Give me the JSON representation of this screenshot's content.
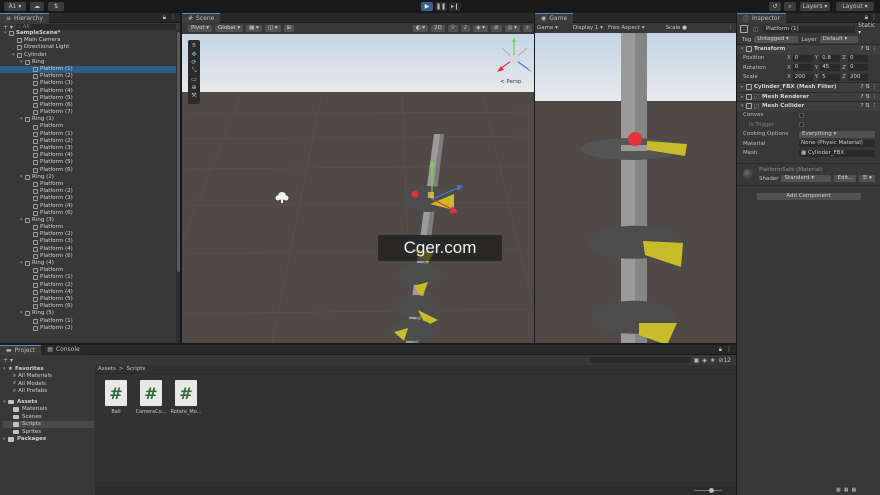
{
  "toolbar": {
    "account": "A1 ▾",
    "layers": "Layers",
    "layout": "Layout"
  },
  "hierarchy": {
    "tab": "Hierarchy",
    "search_placeholder": "All",
    "rows": [
      {
        "label": "SampleScene*",
        "depth": 0,
        "arrow": "▾",
        "bold": true
      },
      {
        "label": "Main Camera",
        "depth": 1,
        "arrow": ""
      },
      {
        "label": "Directional Light",
        "depth": 1,
        "arrow": ""
      },
      {
        "label": "Cylinder",
        "depth": 1,
        "arrow": "▾"
      },
      {
        "label": "Ring",
        "depth": 2,
        "arrow": "▾"
      },
      {
        "label": "Platform (1)",
        "depth": 3,
        "arrow": "",
        "selected": true
      },
      {
        "label": "Platform (2)",
        "depth": 3,
        "arrow": ""
      },
      {
        "label": "Platform (3)",
        "depth": 3,
        "arrow": ""
      },
      {
        "label": "Platform (4)",
        "depth": 3,
        "arrow": ""
      },
      {
        "label": "Platform (5)",
        "depth": 3,
        "arrow": ""
      },
      {
        "label": "Platform (6)",
        "depth": 3,
        "arrow": ""
      },
      {
        "label": "Platform (7)",
        "depth": 3,
        "arrow": ""
      },
      {
        "label": "Ring (1)",
        "depth": 2,
        "arrow": "▾"
      },
      {
        "label": "Platform",
        "depth": 3,
        "arrow": ""
      },
      {
        "label": "Platform (1)",
        "depth": 3,
        "arrow": ""
      },
      {
        "label": "Platform (2)",
        "depth": 3,
        "arrow": ""
      },
      {
        "label": "Platform (3)",
        "depth": 3,
        "arrow": ""
      },
      {
        "label": "Platform (4)",
        "depth": 3,
        "arrow": ""
      },
      {
        "label": "Platform (5)",
        "depth": 3,
        "arrow": ""
      },
      {
        "label": "Platform (6)",
        "depth": 3,
        "arrow": ""
      },
      {
        "label": "Ring (2)",
        "depth": 2,
        "arrow": "▾"
      },
      {
        "label": "Platform",
        "depth": 3,
        "arrow": ""
      },
      {
        "label": "Platform (2)",
        "depth": 3,
        "arrow": ""
      },
      {
        "label": "Platform (3)",
        "depth": 3,
        "arrow": ""
      },
      {
        "label": "Platform (4)",
        "depth": 3,
        "arrow": ""
      },
      {
        "label": "Platform (6)",
        "depth": 3,
        "arrow": ""
      },
      {
        "label": "Ring (3)",
        "depth": 2,
        "arrow": "▾"
      },
      {
        "label": "Platform",
        "depth": 3,
        "arrow": ""
      },
      {
        "label": "Platform (2)",
        "depth": 3,
        "arrow": ""
      },
      {
        "label": "Platform (3)",
        "depth": 3,
        "arrow": ""
      },
      {
        "label": "Platform (4)",
        "depth": 3,
        "arrow": ""
      },
      {
        "label": "Platform (6)",
        "depth": 3,
        "arrow": ""
      },
      {
        "label": "Ring (4)",
        "depth": 2,
        "arrow": "▾"
      },
      {
        "label": "Platform",
        "depth": 3,
        "arrow": ""
      },
      {
        "label": "Platform (1)",
        "depth": 3,
        "arrow": ""
      },
      {
        "label": "Platform (2)",
        "depth": 3,
        "arrow": ""
      },
      {
        "label": "Platform (4)",
        "depth": 3,
        "arrow": ""
      },
      {
        "label": "Platform (5)",
        "depth": 3,
        "arrow": ""
      },
      {
        "label": "Platform (6)",
        "depth": 3,
        "arrow": ""
      },
      {
        "label": "Ring (5)",
        "depth": 2,
        "arrow": "▾"
      },
      {
        "label": "Platform (1)",
        "depth": 3,
        "arrow": ""
      },
      {
        "label": "Platform (2)",
        "depth": 3,
        "arrow": ""
      }
    ]
  },
  "scene": {
    "tab": "Scene",
    "pivot": "Pivot",
    "global": "Global",
    "mode_2d": "2D",
    "persp": "< Persp"
  },
  "game": {
    "tab": "Game",
    "mode": "Game",
    "display": "Display 1",
    "aspect": "Free Aspect",
    "scale": "Scale"
  },
  "inspector": {
    "tab": "Inspector",
    "object_name": "Platform (1)",
    "static_label": "Static",
    "tag_label": "Tag",
    "tag_value": "Untagged",
    "layer_label": "Layer",
    "layer_value": "Default",
    "transform": {
      "title": "Transform",
      "rows": [
        {
          "label": "Position",
          "x": "0",
          "y": "0.8",
          "z": "0"
        },
        {
          "label": "Rotation",
          "x": "0",
          "y": "45",
          "z": "0"
        },
        {
          "label": "Scale",
          "x": "200",
          "y": "5",
          "z": "200"
        }
      ]
    },
    "components": [
      {
        "title": "Cylinder_FBX (Mesh Filter)",
        "checkbox": false
      },
      {
        "title": "Mesh Renderer",
        "checkbox": true
      },
      {
        "title": "Mesh Collider",
        "checkbox": true
      }
    ],
    "collider": {
      "convex": "Convex",
      "is_trigger": "Is Trigger",
      "cooking_label": "Cooking Options",
      "cooking_value": "Everything",
      "material_label": "Material",
      "material_value": "None (Physic Material)",
      "mesh_label": "Mesh",
      "mesh_value": "Cylinder_FBX"
    },
    "material": {
      "title": "PlatformSafe (Material)",
      "shader_label": "Shader",
      "shader_value": "Standard",
      "edit": "Edit..."
    },
    "add_component": "Add Component"
  },
  "project": {
    "tab_project": "Project",
    "tab_console": "Console",
    "count": "12",
    "breadcrumb_root": "Assets",
    "breadcrumb_sep": ">",
    "breadcrumb_current": "Scripts",
    "favorites": "Favorites",
    "favorites_items": [
      "All Materials",
      "All Models",
      "All Prefabs"
    ],
    "assets": "Assets",
    "assets_items": [
      "Materials",
      "Scenes",
      "Scripts",
      "Sprites"
    ],
    "packages": "Packages",
    "scripts": [
      {
        "name": "Ball"
      },
      {
        "name": "CameraCo..."
      },
      {
        "name": "Rotate_Mo..."
      }
    ]
  },
  "watermark": "Cger.com",
  "colors": {
    "accent": "#4a8fd8",
    "selection": "#2c5d87",
    "platform_dark": "#4d4d4d",
    "platform_yellow": "#c7bd2a",
    "ball_red": "#e8303a",
    "pillar": "#9a9a9a"
  }
}
